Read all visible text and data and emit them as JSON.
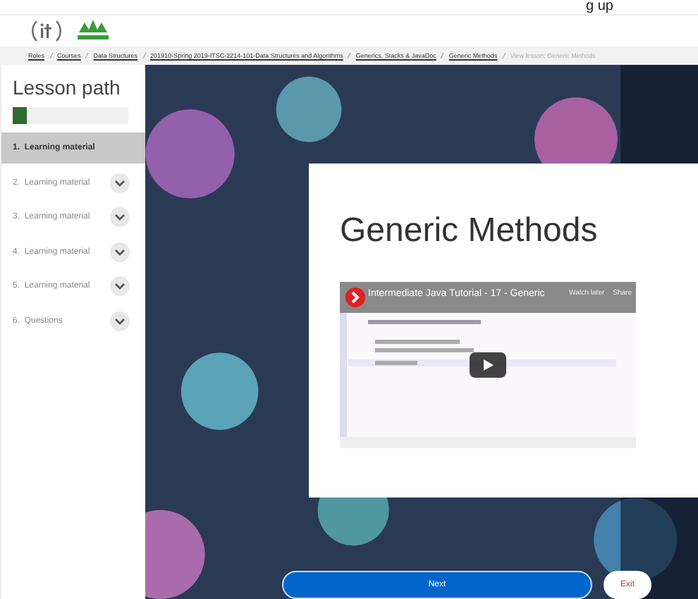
{
  "top_fragment": "g up",
  "breadcrumbs": [
    {
      "label": "Roles",
      "current": false
    },
    {
      "label": "Courses",
      "current": false
    },
    {
      "label": "Data Structures",
      "current": false
    },
    {
      "label": "201910-Spring 2019-ITSC-2214-101-Data Structures and Algorithms",
      "current": false
    },
    {
      "label": "Generics, Stacks & JavaDoc",
      "current": false
    },
    {
      "label": "Generic Methods",
      "current": false
    },
    {
      "label": "View lesson: Generic Methods",
      "current": true
    }
  ],
  "sidebar": {
    "title": "Lesson path",
    "progress": {
      "level": 0.12
    },
    "items": [
      {
        "label": "1.  Learning material",
        "selected": true,
        "expandable": false
      },
      {
        "label": "2.  Learning material",
        "selected": false,
        "expandable": true
      },
      {
        "label": "3.  Learning material",
        "selected": false,
        "expandable": true
      },
      {
        "label": "4.  Learning material",
        "selected": false,
        "expandable": true
      },
      {
        "label": "5.  Learning material",
        "selected": false,
        "expandable": true
      },
      {
        "label": "6.  Questions",
        "selected": false,
        "expandable": true
      }
    ]
  },
  "lesson": {
    "title": "Generic Methods",
    "video": {
      "title": "Intermediate Java Tutorial - 17 - Generic",
      "actions": [
        "Watch later",
        "Share"
      ]
    }
  },
  "buttons": [
    {
      "label": "Next",
      "kind": "primary"
    },
    {
      "label": "Exit",
      "kind": "secondary"
    }
  ]
}
